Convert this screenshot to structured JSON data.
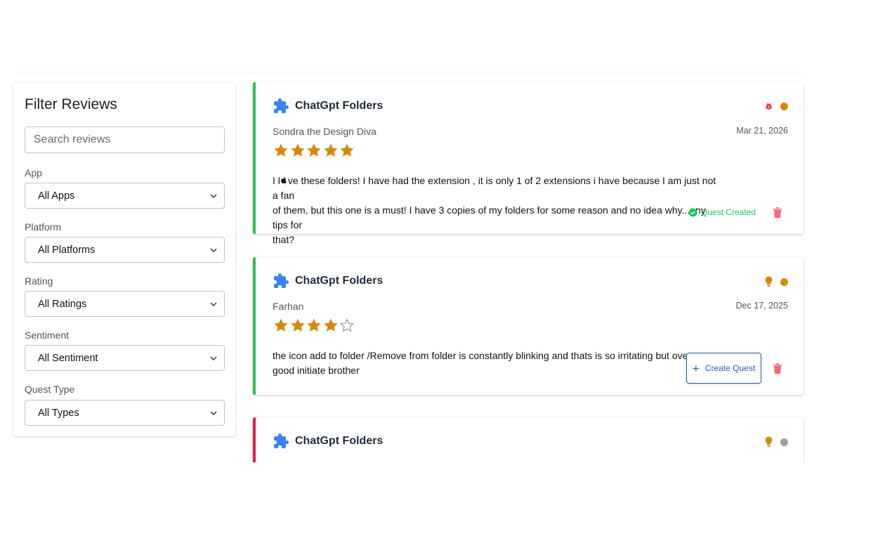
{
  "filters": {
    "title": "Filter Reviews",
    "search_placeholder": "Search reviews",
    "app": {
      "label": "App",
      "value": "All Apps"
    },
    "platform": {
      "label": "Platform",
      "value": "All Platforms"
    },
    "rating": {
      "label": "Rating",
      "value": "All Ratings"
    },
    "sentiment": {
      "label": "Sentiment",
      "value": "All Sentiment"
    },
    "quest_type": {
      "label": "Quest Type",
      "value": "All Types"
    }
  },
  "reviews": [
    {
      "app": "ChatGpt Folders",
      "author": "Sondra the Design Diva",
      "date": "Mar 21, 2026",
      "rating": 5,
      "text_line1": "I l",
      "text_line1b": "ve these folders! I have had the extension , it is only 1 of 2 extensions i have because I am just not a fan",
      "text_line2": "of them, but this one is a must! I have 3 copies of my folders for some reason and no idea why...any tips for",
      "text_line3": "that?",
      "quest_status": "Quest Created",
      "type_icon": "bug-icon",
      "sentiment_color": "#d4890a",
      "accent": "#2fbf4f"
    },
    {
      "app": "ChatGpt Folders",
      "author": "Farhan",
      "date": "Dec 17, 2025",
      "rating": 4,
      "text_line1": "the icon add to folder /Remove from folder is constantly blinking and thats is so irritating but overall",
      "text_line2": "good initiate brother",
      "create_label": "Create Quest",
      "type_icon": "lightbulb-icon",
      "sentiment_color": "#d4890a",
      "accent": "#2fbf4f"
    },
    {
      "app": "ChatGpt Folders",
      "type_icon": "lightbulb-icon",
      "sentiment_color": "#9e9e9e",
      "accent": "#e11d48"
    }
  ],
  "colors": {
    "star": "#d4890a",
    "puzzle": "#3b82f6",
    "bug": "#e0314f",
    "trash": "#ef6b7a",
    "quest_created": "#22c55e",
    "button": "#1e5fa8"
  }
}
